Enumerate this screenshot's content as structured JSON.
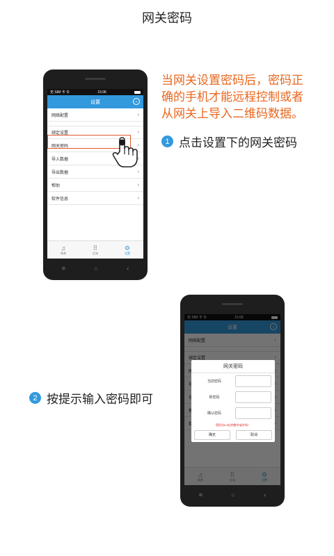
{
  "page": {
    "title": "网关密码"
  },
  "callout": {
    "line1": "当网关设置密码后，密码正",
    "line2": "确的手机才能远程控制或者",
    "line3": "从网关上导入二维码数据。"
  },
  "step1": {
    "number": "1",
    "text": "点击设置下的网关密码"
  },
  "step2": {
    "number": "2",
    "text": "按提示输入密码即可"
  },
  "phone": {
    "status": {
      "carrier": "无 SIM 卡 令",
      "time": "15:06"
    },
    "header": {
      "title": "设置"
    },
    "menu": [
      {
        "label": "网络配置"
      },
      {
        "label": "绑定设置"
      },
      {
        "label": "网关密码"
      },
      {
        "label": "导入数据"
      },
      {
        "label": "导出数据"
      },
      {
        "label": "帮助"
      },
      {
        "label": "软件信息"
      }
    ],
    "chevron": "›",
    "tabs": [
      {
        "label": "情景"
      },
      {
        "label": "区域"
      },
      {
        "label": "设置"
      }
    ],
    "nav": {
      "menu": "≡",
      "home": "○",
      "back": "‹"
    }
  },
  "dialog": {
    "title": "网关密码",
    "fields": [
      {
        "label": "当前密码"
      },
      {
        "label": "新密码"
      },
      {
        "label": "确认密码"
      }
    ],
    "hint": "密码为6-8位的数字或字母！",
    "confirm": "确定",
    "cancel": "取消"
  },
  "colors": {
    "accent": "#3399dd",
    "highlight": "#e05a2b",
    "callout": "#e8671f",
    "error": "#e02020"
  },
  "icons": {
    "scene": "scene-icon",
    "area": "grid-icon",
    "settings": "gear-icon",
    "pointer": "hand-pointer-icon"
  }
}
